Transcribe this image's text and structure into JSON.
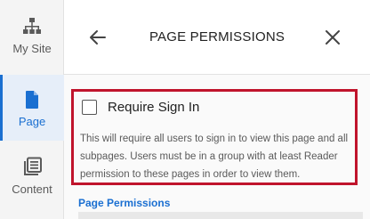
{
  "sidebar": {
    "items": [
      {
        "label": "My Site",
        "icon": "sitemap-icon",
        "active": false
      },
      {
        "label": "Page",
        "icon": "page-icon",
        "active": true
      },
      {
        "label": "Content",
        "icon": "content-icon",
        "active": false
      }
    ]
  },
  "panel": {
    "title": "PAGE PERMISSIONS",
    "back_icon": "back-arrow-icon",
    "close_icon": "close-icon",
    "require_sign_in": {
      "label": "Require Sign In",
      "checked": false,
      "description": "This will require all users to sign in to view this page and all subpages. Users must be in a group with at least Reader permission to these pages in order to view them."
    },
    "section_title": "Page Permissions"
  },
  "colors": {
    "accent": "#1a6fd1",
    "highlight_border": "#c0142c"
  }
}
